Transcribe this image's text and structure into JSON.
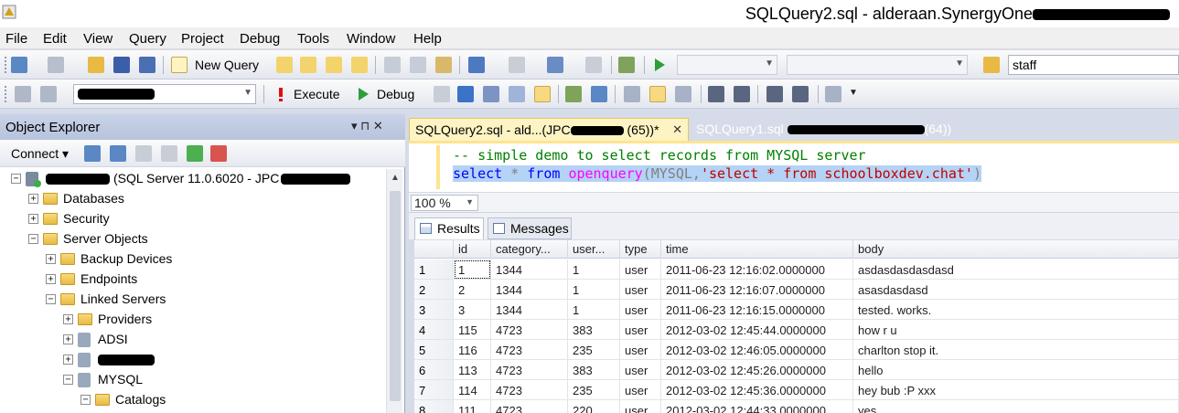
{
  "window": {
    "title_prefix": "SQLQuery2.sql - alderaan.SynergyOne"
  },
  "menu": [
    "File",
    "Edit",
    "View",
    "Query",
    "Project",
    "Debug",
    "Tools",
    "Window",
    "Help"
  ],
  "toolbar1": {
    "new_query_label": "New Query",
    "search_value": "staff"
  },
  "toolbar2": {
    "database_value": "",
    "execute_label": "Execute",
    "debug_label": "Debug"
  },
  "object_explorer": {
    "title": "Object Explorer",
    "pin_label": "▾ ⊓ ✕",
    "connect_label": "Connect ▾",
    "tree": [
      {
        "label": "(SQL Server 11.0.6020 - JPC",
        "expanded": true,
        "icon": "server-icon",
        "redacted_prefix": true,
        "redacted_suffix": true,
        "level": 0
      },
      {
        "label": "Databases",
        "expanded": false,
        "icon": "folder-icon",
        "level": 1
      },
      {
        "label": "Security",
        "expanded": false,
        "icon": "folder-icon",
        "level": 1
      },
      {
        "label": "Server Objects",
        "expanded": true,
        "icon": "folder-icon",
        "level": 1
      },
      {
        "label": "Backup Devices",
        "expanded": false,
        "icon": "folder-icon",
        "level": 2
      },
      {
        "label": "Endpoints",
        "expanded": false,
        "icon": "folder-icon",
        "level": 2
      },
      {
        "label": "Linked Servers",
        "expanded": true,
        "icon": "folder-icon",
        "level": 2
      },
      {
        "label": "Providers",
        "expanded": false,
        "icon": "folder-icon",
        "level": 3
      },
      {
        "label": "ADSI",
        "expanded": false,
        "icon": "linked-server-icon",
        "level": 3
      },
      {
        "label": "",
        "expanded": false,
        "icon": "linked-server-icon",
        "redacted_prefix": true,
        "level": 3
      },
      {
        "label": "MYSQL",
        "expanded": true,
        "icon": "linked-server-icon",
        "level": 3
      },
      {
        "label": "Catalogs",
        "expanded": true,
        "icon": "folder-icon",
        "level": 4
      }
    ]
  },
  "tabs": {
    "active_label": "SQLQuery2.sql - ald...(JPC",
    "active_suffix": "(65))*",
    "inactive_label": "SQLQuery1.sql",
    "inactive_suffix": "(64))"
  },
  "editor": {
    "comment_line": "-- simple demo to select records from MYSQL server",
    "kw_select": "select",
    "star": " * ",
    "kw_from": "from",
    "fn_openquery": "openquery",
    "paren_open": "(MYSQL,",
    "string_literal": "'select * from schoolboxdev.chat'",
    "paren_close": ")"
  },
  "zoom": {
    "value": "100 %"
  },
  "result_tabs": {
    "results": "Results",
    "messages": "Messages"
  },
  "grid": {
    "columns": [
      "",
      "id",
      "category...",
      "user...",
      "type",
      "time",
      "body"
    ],
    "rows": [
      [
        "1",
        "1",
        "1344",
        "1",
        "user",
        "2011-06-23 12:16:02.0000000",
        "asdasdasdasdasd"
      ],
      [
        "2",
        "2",
        "1344",
        "1",
        "user",
        "2011-06-23 12:16:07.0000000",
        "asasdasdasd"
      ],
      [
        "3",
        "3",
        "1344",
        "1",
        "user",
        "2011-06-23 12:16:15.0000000",
        "tested. works."
      ],
      [
        "4",
        "115",
        "4723",
        "383",
        "user",
        "2012-03-02 12:45:44.0000000",
        "how r u"
      ],
      [
        "5",
        "116",
        "4723",
        "235",
        "user",
        "2012-03-02 12:46:05.0000000",
        "charlton stop it."
      ],
      [
        "6",
        "113",
        "4723",
        "383",
        "user",
        "2012-03-02 12:45:26.0000000",
        "hello"
      ],
      [
        "7",
        "114",
        "4723",
        "235",
        "user",
        "2012-03-02 12:45:36.0000000",
        "hey bub :P xxx"
      ],
      [
        "8",
        "111",
        "4723",
        "220",
        "user",
        "2012-03-02 12:44:33.0000000",
        "yes"
      ]
    ]
  }
}
